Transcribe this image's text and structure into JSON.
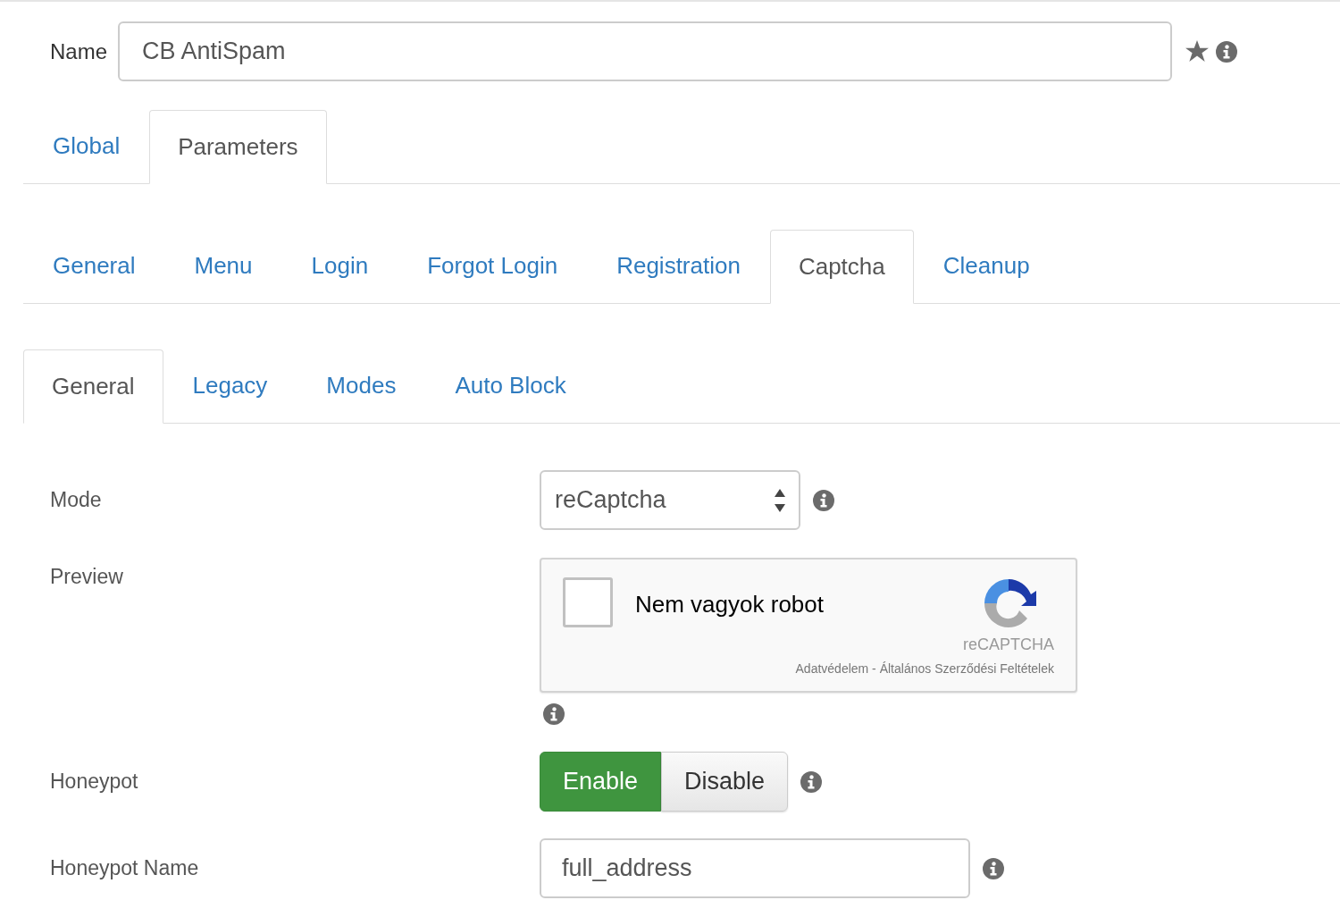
{
  "name": {
    "label": "Name",
    "value": "CB AntiSpam"
  },
  "tab_levels": [
    [
      {
        "label": "Global",
        "selected": false
      },
      {
        "label": "Parameters",
        "selected": true
      }
    ],
    [
      {
        "label": "General",
        "selected": false
      },
      {
        "label": "Menu",
        "selected": false
      },
      {
        "label": "Login",
        "selected": false
      },
      {
        "label": "Forgot Login",
        "selected": false
      },
      {
        "label": "Registration",
        "selected": false
      },
      {
        "label": "Captcha",
        "selected": true
      },
      {
        "label": "Cleanup",
        "selected": false
      }
    ],
    [
      {
        "label": "General",
        "selected": true
      },
      {
        "label": "Legacy",
        "selected": false
      },
      {
        "label": "Modes",
        "selected": false
      },
      {
        "label": "Auto Block",
        "selected": false
      }
    ]
  ],
  "fields": [
    {
      "kind": "select",
      "label": "Mode",
      "value": "reCaptcha"
    },
    {
      "kind": "recaptcha",
      "label": "Preview",
      "checked": false,
      "text": "Nem vagyok robot",
      "brand": "reCAPTCHA",
      "terms": "Adatvédelem - Általános Szerződési Feltételek"
    },
    {
      "kind": "toggle",
      "label": "Honeypot",
      "options": [
        {
          "label": "Enable",
          "selected": true
        },
        {
          "label": "Disable",
          "selected": false
        }
      ]
    },
    {
      "kind": "text",
      "label": "Honeypot Name",
      "value": "full_address"
    }
  ]
}
